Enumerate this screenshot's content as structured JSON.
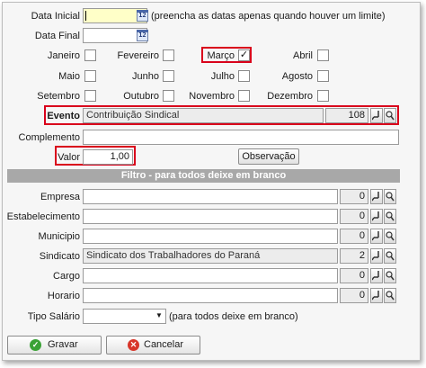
{
  "dates": {
    "initial_label": "Data Inicial",
    "initial_value": "",
    "hint": "(preencha as datas apenas quando houver um limite)",
    "final_label": "Data Final",
    "final_value": "",
    "calendar_text": "12"
  },
  "months": [
    {
      "label": "Janeiro",
      "checked": false
    },
    {
      "label": "Fevereiro",
      "checked": false
    },
    {
      "label": "Março",
      "checked": true
    },
    {
      "label": "Abril",
      "checked": false
    },
    {
      "label": "Maio",
      "checked": false
    },
    {
      "label": "Junho",
      "checked": false
    },
    {
      "label": "Julho",
      "checked": false
    },
    {
      "label": "Agosto",
      "checked": false
    },
    {
      "label": "Setembro",
      "checked": false
    },
    {
      "label": "Outubro",
      "checked": false
    },
    {
      "label": "Novembro",
      "checked": false
    },
    {
      "label": "Dezembro",
      "checked": false
    }
  ],
  "check_mark": "✓",
  "evento": {
    "label": "Evento",
    "value": "Contribuição Sindical",
    "code": "108"
  },
  "complemento": {
    "label": "Complemento",
    "value": ""
  },
  "valor": {
    "label": "Valor",
    "value": "1,00"
  },
  "observacao_button": "Observação",
  "filter_title": "Filtro - para todos deixe em branco",
  "filters": [
    {
      "label": "Empresa",
      "value": "",
      "code": "0"
    },
    {
      "label": "Estabelecimento",
      "value": "",
      "code": "0"
    },
    {
      "label": "Municipio",
      "value": "",
      "code": "0"
    },
    {
      "label": "Sindicato",
      "value": "Sindicato dos Trabalhadores do Paraná",
      "code": "2"
    },
    {
      "label": "Cargo",
      "value": "",
      "code": "0"
    },
    {
      "label": "Horario",
      "value": "",
      "code": "0"
    }
  ],
  "tipo_salario": {
    "label": "Tipo Salário",
    "value": "",
    "hint": "(para todos deixe em branco)"
  },
  "actions": {
    "save": "Gravar",
    "cancel": "Cancelar"
  },
  "colors": {
    "highlight": "#d9001b",
    "save_icon": "#3aa236",
    "cancel_icon": "#d8362a",
    "section_bg": "#a8a8a8"
  }
}
